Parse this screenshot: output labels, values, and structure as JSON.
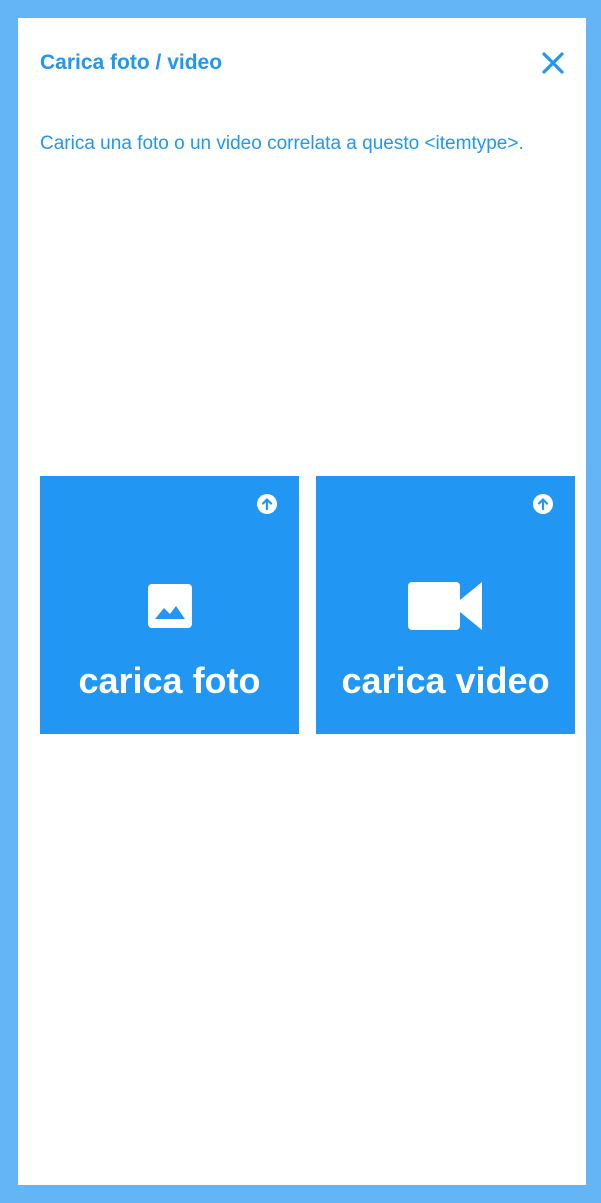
{
  "dialog": {
    "title": "Carica foto / video",
    "description": "Carica una foto o un video correlata a questo <itemtype>.",
    "close_icon": "close-icon"
  },
  "tiles": [
    {
      "label": "carica foto",
      "icon": "image-icon",
      "badge_icon": "upload-arrow-icon"
    },
    {
      "label": "carica video",
      "icon": "videocam-icon",
      "badge_icon": "upload-arrow-icon"
    }
  ],
  "colors": {
    "accent": "#2196f3",
    "frame": "#64b5f6",
    "background": "#ffffff",
    "tile_text": "#ffffff"
  }
}
